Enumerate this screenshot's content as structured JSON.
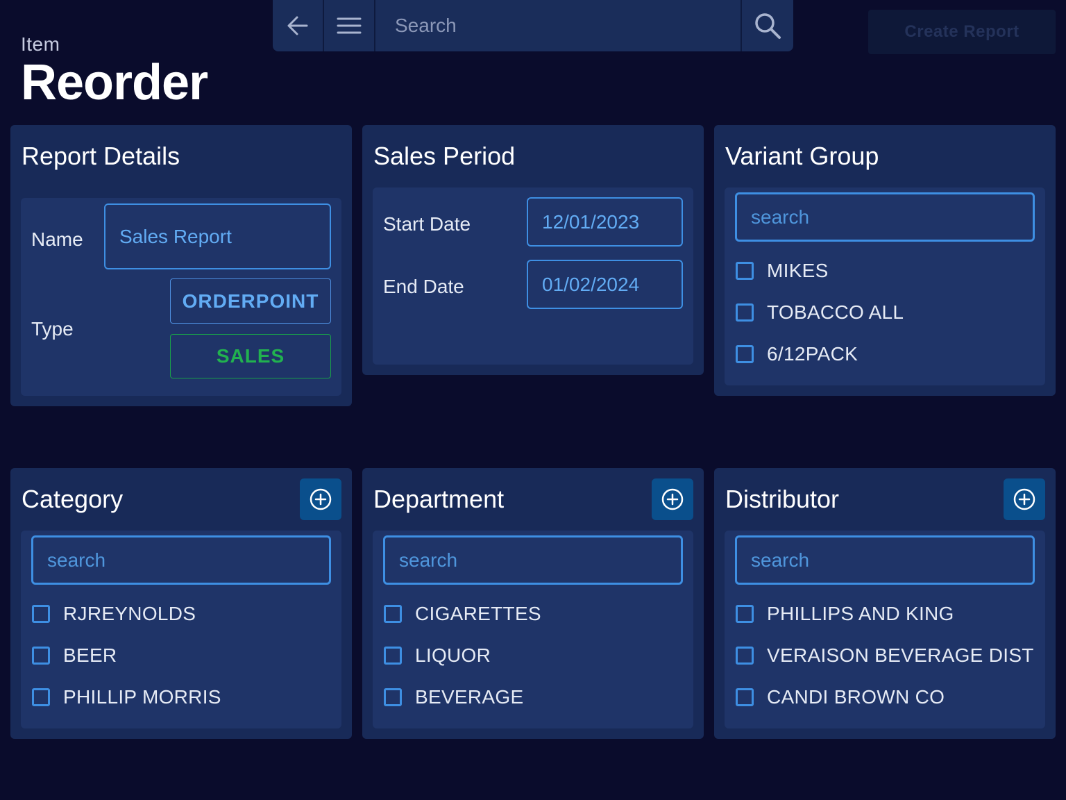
{
  "header": {
    "subtitle": "Item",
    "title": "Reorder"
  },
  "topbar": {
    "search_placeholder": "Search",
    "back_icon": "arrow-left-icon",
    "menu_icon": "hamburger-menu-icon",
    "search_icon": "magnifier-icon"
  },
  "actions": {
    "create_report": "Create Report"
  },
  "report_details": {
    "title": "Report Details",
    "name_label": "Name",
    "name_value": "Sales Report",
    "type_label": "Type",
    "type_options": [
      "ORDERPOINT",
      "SALES"
    ]
  },
  "sales_period": {
    "title": "Sales Period",
    "start_label": "Start Date",
    "start_value": "12/01/2023",
    "end_label": "End Date",
    "end_value": "01/02/2024"
  },
  "variant_group": {
    "title": "Variant Group",
    "search_placeholder": "search",
    "items": [
      "MIKES",
      "TOBACCO ALL",
      "6/12PACK"
    ]
  },
  "category": {
    "title": "Category",
    "search_placeholder": "search",
    "items": [
      "RJREYNOLDS",
      "BEER",
      "PHILLIP MORRIS"
    ]
  },
  "department": {
    "title": "Department",
    "search_placeholder": "search",
    "items": [
      "CIGARETTES",
      "LIQUOR",
      "BEVERAGE"
    ]
  },
  "distributor": {
    "title": "Distributor",
    "search_placeholder": "search",
    "items": [
      "PHILLIPS AND KING",
      "VERAISON BEVERAGE DIST",
      "CANDI BROWN CO"
    ]
  },
  "colors": {
    "background": "#0a0c2c",
    "card": "#182a58",
    "accent_blue": "#3e8fe3",
    "accent_green": "#21b24f",
    "add_button": "#0a4f8c"
  }
}
